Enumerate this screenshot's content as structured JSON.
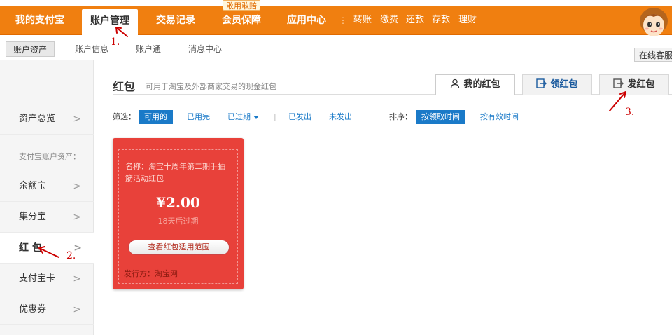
{
  "topnav": {
    "items": [
      "我的支付宝",
      "账户管理",
      "交易记录",
      "会员保障",
      "应用中心"
    ],
    "badge": "敢用敢赔",
    "quick_links": [
      "转账",
      "缴费",
      "还款",
      "存款",
      "理财"
    ]
  },
  "subnav": {
    "items": [
      "账户资产",
      "账户信息",
      "账户通",
      "消息中心"
    ]
  },
  "service": {
    "label": "在线客服"
  },
  "sidebar": {
    "items": [
      "资产总览",
      "余额宝",
      "集分宝",
      "红 包",
      "支付宝卡",
      "优惠券"
    ],
    "heading": "支付宝账户资产：",
    "chevron": ">"
  },
  "main": {
    "title": "红包",
    "subtitle": "可用于淘宝及外部商家交易的现金红包",
    "tabs": [
      "我的红包",
      "领红包",
      "发红包"
    ],
    "filter_label": "筛选：",
    "filters": [
      "可用的",
      "已用完",
      "已过期",
      "已发出",
      "未发出"
    ],
    "divider": "|",
    "sort_label": "排序：",
    "sorts": [
      "按领取时间",
      "按有效时间"
    ]
  },
  "card": {
    "name": "名称：淘宝十周年第二期手抽筋活动红包",
    "amount": "¥2.00",
    "expire": "18天后过期",
    "button": "查看红包适用范围",
    "issuer": "发行方：淘宝网"
  },
  "annotations": [
    "1.",
    "2.",
    "3."
  ],
  "colors": {
    "nav_orange": "#f07f10",
    "link_blue": "#1a7ac8",
    "envelope_red": "#e8413a",
    "annotation_red": "#cc0000"
  },
  "icons": [
    "user-icon",
    "receive-icon",
    "send-icon",
    "chevron-right-icon",
    "caret-down-icon",
    "service-avatar-icon"
  ]
}
